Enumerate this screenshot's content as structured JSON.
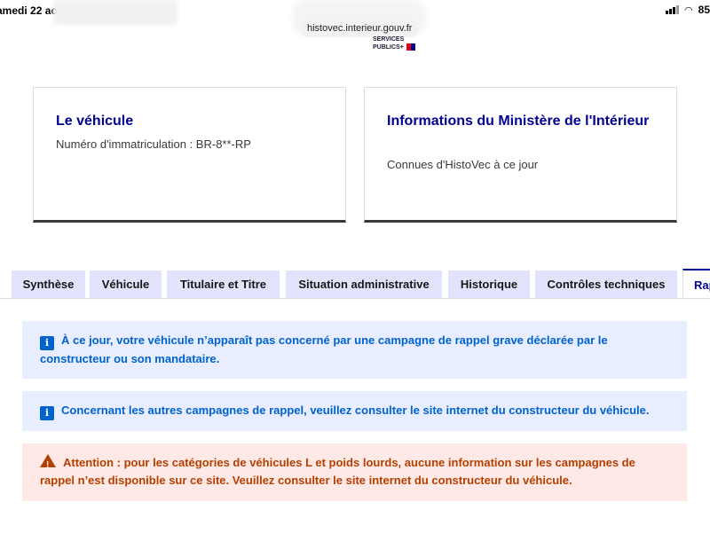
{
  "status_bar": {
    "date": "amedi 22 août",
    "battery": "85"
  },
  "browser": {
    "url": "histovec.interieur.gouv.fr"
  },
  "logo": {
    "line1": "SERVICES",
    "line2": "PUBLICS+"
  },
  "cards": {
    "vehicle": {
      "title": "Le véhicule",
      "description": "Numéro d'immatriculation : BR-8**-RP"
    },
    "ministry": {
      "title": "Informations du Ministère de l'Intérieur",
      "description": "Connues d'HistoVec à ce jour"
    }
  },
  "tabs": [
    {
      "label": "Synthèse"
    },
    {
      "label": "Véhicule"
    },
    {
      "label": "Titulaire et Titre"
    },
    {
      "label": "Situation administrative"
    },
    {
      "label": "Historique"
    },
    {
      "label": "Contrôles techniques"
    },
    {
      "label": "Rap",
      "active": true
    }
  ],
  "alerts": [
    {
      "type": "info",
      "icon": "info-icon",
      "text": "À ce jour, votre véhicule n’apparaît pas concerné par une campagne de rappel grave déclarée par le constructeur ou son mandataire."
    },
    {
      "type": "info",
      "icon": "info-icon",
      "text": "Concernant les autres campagnes de rappel, veuillez consulter le site internet du constructeur du véhicule."
    },
    {
      "type": "warning",
      "icon": "warning-icon",
      "text": "Attention : pour les catégories de véhicules L et poids lourds, aucune information sur les campagnes de rappel n’est disponible sur ce site. Veuillez consulter le site internet du constructeur du véhicule."
    }
  ],
  "colors": {
    "brand_blue": "#000091",
    "info_text": "#0063cb",
    "info_bg": "#e8edff",
    "warning_text": "#b34000",
    "warning_bg": "#ffe9e6",
    "tab_bg": "#e3e3fd"
  }
}
